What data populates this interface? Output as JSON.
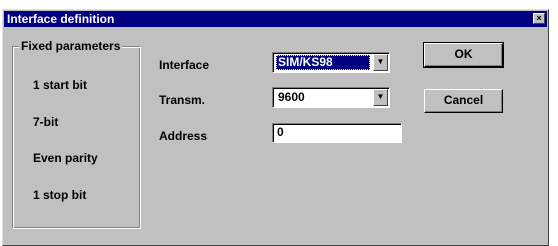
{
  "window": {
    "title": "Interface definition",
    "close_glyph": "×"
  },
  "fixed_parameters": {
    "legend": "Fixed parameters",
    "items": [
      "1 start bit",
      "7-bit",
      "Even parity",
      "1 stop bit"
    ]
  },
  "form": {
    "interface_label": "Interface",
    "interface_value": "SIM/KS98",
    "transm_label": "Transm.",
    "transm_value": "9600",
    "address_label": "Address",
    "address_value": "0",
    "dropdown_glyph": "▼"
  },
  "buttons": {
    "ok_label": "OK",
    "cancel_label": "Cancel"
  }
}
